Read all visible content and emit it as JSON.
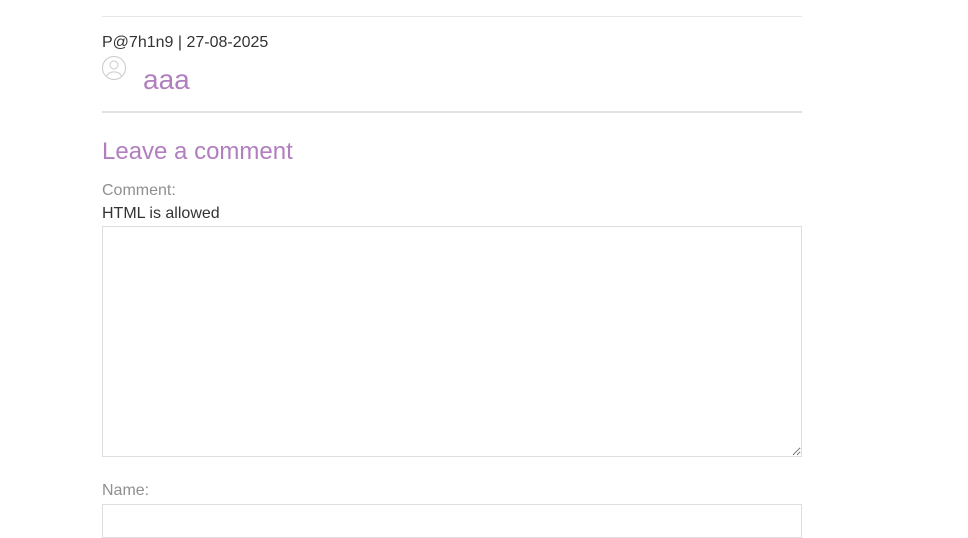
{
  "comment": {
    "meta": "P@7h1n9 | 27-08-2025",
    "avatar_icon": "user-avatar-icon",
    "body": "aaa"
  },
  "form": {
    "title": "Leave a comment",
    "comment_label": "Comment:",
    "html_hint": "HTML is allowed",
    "comment_value": "",
    "name_label": "Name:",
    "name_value": ""
  },
  "colors": {
    "accent": "#b17ec0",
    "text": "#333333",
    "label": "#8f8f8f",
    "border": "#dedede"
  }
}
